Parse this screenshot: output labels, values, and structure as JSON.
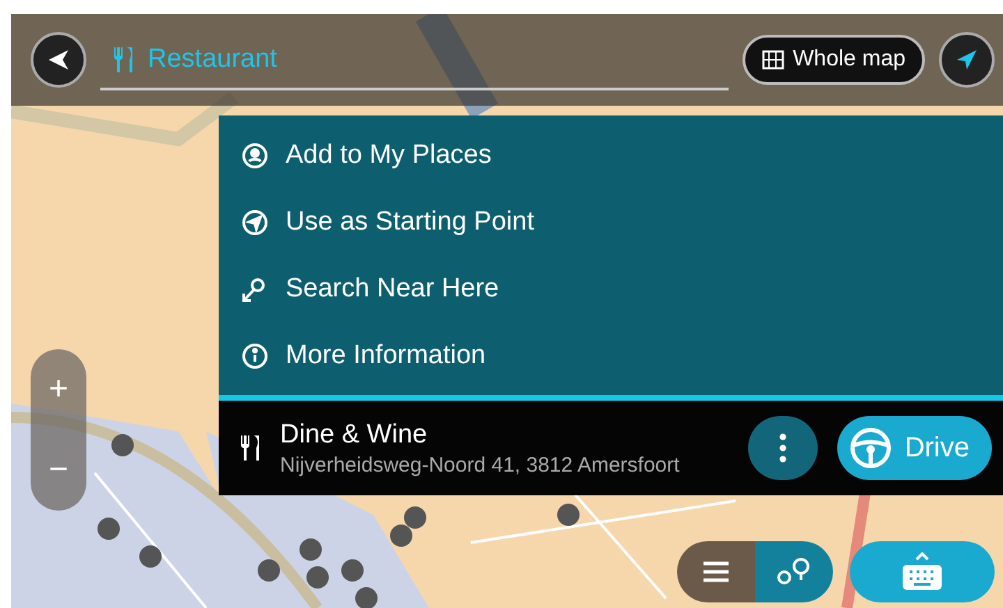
{
  "search_bar": {
    "query": "Restaurant"
  },
  "whole_map_button": {
    "label": "Whole map"
  },
  "menu": {
    "items": [
      {
        "kind": "place",
        "label": "Add to My Places"
      },
      {
        "kind": "start",
        "label": "Use as Starting Point"
      },
      {
        "kind": "search",
        "label": "Search Near Here"
      },
      {
        "kind": "info",
        "label": "More Information"
      }
    ]
  },
  "result": {
    "name": "Dine & Wine",
    "address": "Nijverheidsweg-Noord 41, 3812 Amersfoort"
  },
  "drive_button": {
    "label": "Drive"
  },
  "zoom": {
    "zoom_in": "+",
    "zoom_out": "−"
  },
  "view_toggle": [
    {
      "kind": "list",
      "selected": false
    },
    {
      "kind": "map",
      "selected": true
    }
  ]
}
